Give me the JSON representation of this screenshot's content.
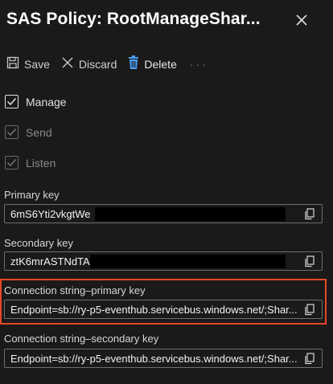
{
  "header": {
    "title": "SAS Policy: RootManageShar...",
    "close_icon": "close-icon"
  },
  "toolbar": {
    "save_label": "Save",
    "discard_label": "Discard",
    "delete_label": "Delete",
    "more_label": "···"
  },
  "claims": [
    {
      "label": "Manage",
      "checked": true,
      "disabled": false
    },
    {
      "label": "Send",
      "checked": true,
      "disabled": true
    },
    {
      "label": "Listen",
      "checked": true,
      "disabled": true
    }
  ],
  "fields": {
    "primary_key": {
      "label": "Primary key",
      "value": "6mS6Yti2vkgtWe"
    },
    "secondary_key": {
      "label": "Secondary key",
      "value": "ztK6mrASTNdTA"
    },
    "conn_primary": {
      "label": "Connection string–primary key",
      "value": "Endpoint=sb://ry-p5-eventhub.servicebus.windows.net/;Shar..."
    },
    "conn_secondary": {
      "label": "Connection string–secondary key",
      "value": "Endpoint=sb://ry-p5-eventhub.servicebus.windows.net/;Shar..."
    }
  },
  "colors": {
    "background": "#1b1a19",
    "delete_icon": "#4a9ff5",
    "highlight": "#e8472a"
  }
}
